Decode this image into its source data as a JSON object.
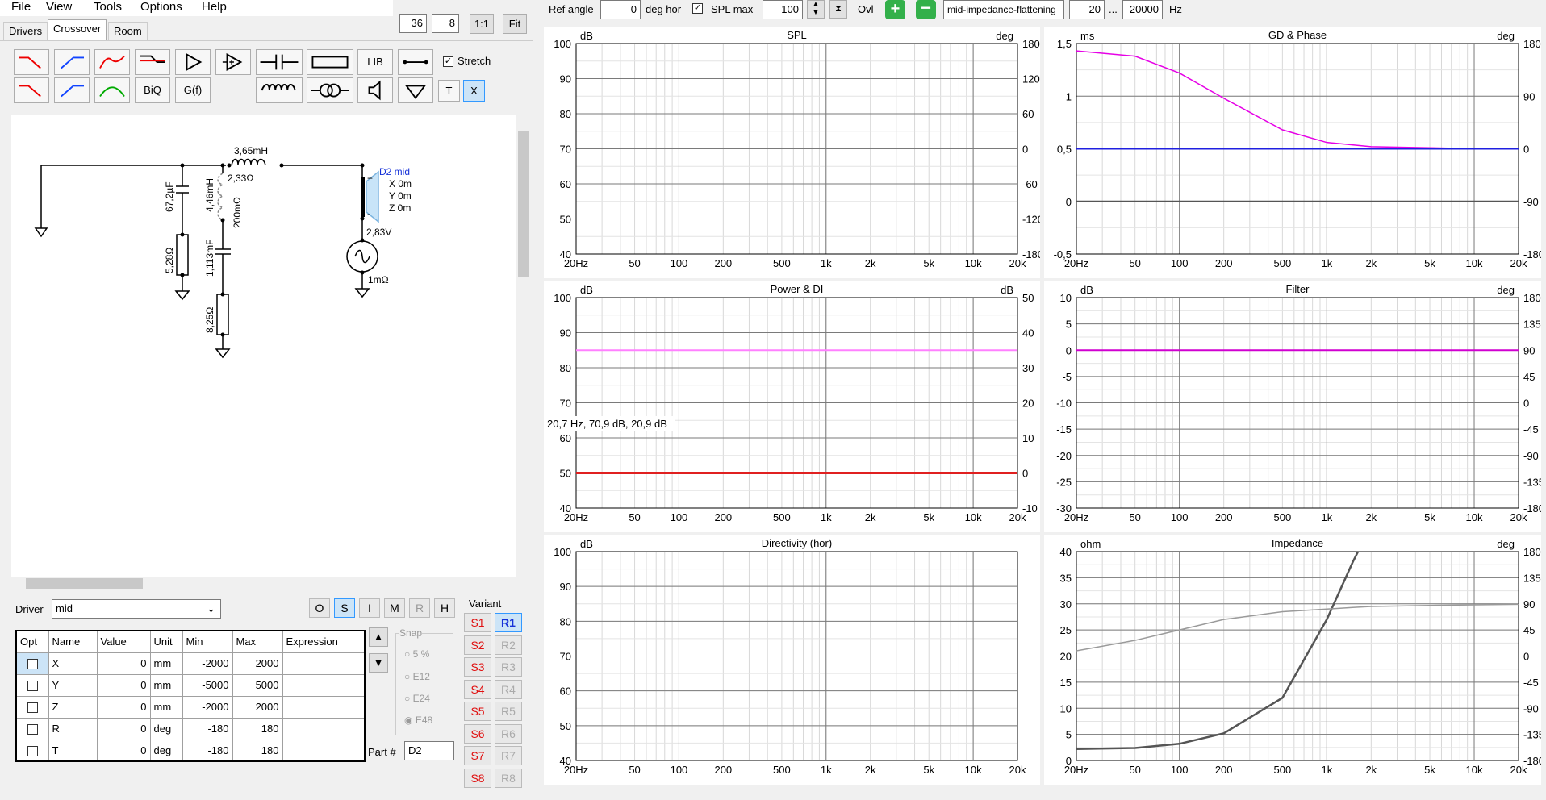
{
  "menu": [
    "File",
    "View",
    "Tools",
    "Options",
    "Help"
  ],
  "tabs": [
    "Drivers",
    "Crossover",
    "Room"
  ],
  "zoom": {
    "a": "36",
    "b": "8",
    "one": "1:1",
    "fit": "Fit"
  },
  "toolbar": {
    "lib": "LIB",
    "stretch": "Stretch",
    "biq": "BiQ",
    "gf": "G(f)",
    "t": "T",
    "x": "X"
  },
  "top": {
    "ref_angle_label": "Ref angle",
    "ref_angle": "0",
    "deg_hor": "deg hor",
    "spl_max_label": "SPL max",
    "spl_max": "100",
    "ovl": "Ovl",
    "preset": "mid-impedance-flattening",
    "f_lo": "20",
    "dots": "...",
    "f_hi": "20000",
    "hz": "Hz"
  },
  "schematic": {
    "L1": "3,65mH",
    "R1": "2,33Ω",
    "C1": "67,2µF",
    "L2": "4,46mH",
    "R2": "200mΩ",
    "R3": "5,28Ω",
    "C2": "1,113mF",
    "R4": "8,25Ω",
    "driver": "D2 mid",
    "x": "X 0m",
    "y": "Y 0m",
    "z": "Z 0m",
    "v": "2,83V",
    "rs": "1mΩ",
    "plus": "+",
    "minus": "-"
  },
  "driver": {
    "label": "Driver",
    "value": "mid",
    "modes": [
      "O",
      "S",
      "I",
      "M",
      "R",
      "H"
    ]
  },
  "table": {
    "headers": [
      "Opt",
      "Name",
      "Value",
      "Unit",
      "Min",
      "Max",
      "Expression"
    ],
    "rows": [
      [
        "X",
        "0",
        "mm",
        "-2000",
        "2000",
        ""
      ],
      [
        "Y",
        "0",
        "mm",
        "-5000",
        "5000",
        ""
      ],
      [
        "Z",
        "0",
        "mm",
        "-2000",
        "2000",
        ""
      ],
      [
        "R",
        "0",
        "deg",
        "-180",
        "180",
        ""
      ],
      [
        "T",
        "0",
        "deg",
        "-180",
        "180",
        ""
      ]
    ]
  },
  "snap": {
    "label": "Snap",
    "options": [
      "5 %",
      "E12",
      "E24",
      "E48"
    ]
  },
  "part": {
    "label": "Part #",
    "value": "D2"
  },
  "variant": {
    "label": "Variant",
    "s": [
      "S1",
      "S2",
      "S3",
      "S4",
      "S5",
      "S6",
      "S7",
      "S8"
    ],
    "r": [
      "R1",
      "R2",
      "R3",
      "R4",
      "R5",
      "R6",
      "R7",
      "R8"
    ]
  },
  "x_ticks": [
    "20Hz",
    "50",
    "100",
    "200",
    "500",
    "1k",
    "2k",
    "5k",
    "10k",
    "20k"
  ],
  "charts": {
    "spl": {
      "title": "SPL",
      "lunit": "dB",
      "runit": "deg",
      "yl": [
        "100",
        "90",
        "80",
        "70",
        "60",
        "50",
        "40"
      ],
      "yr": [
        "180",
        "120",
        "60",
        "0",
        "-60",
        "-120",
        "-180"
      ]
    },
    "gd": {
      "title": "GD & Phase",
      "lunit": "ms",
      "runit": "deg",
      "yl": [
        "1,5",
        "1",
        "0,5",
        "0",
        "-0,5"
      ],
      "yr": [
        "180",
        "90",
        "0",
        "-90",
        "-180"
      ]
    },
    "power": {
      "title": "Power & DI",
      "lunit": "dB",
      "runit": "dB",
      "yl": [
        "100",
        "90",
        "80",
        "70",
        "60",
        "50",
        "40"
      ],
      "yr": [
        "50",
        "40",
        "30",
        "20",
        "10",
        "0",
        "-10"
      ],
      "readout": "20,7 Hz, 70,9 dB, 20,9 dB"
    },
    "filter": {
      "title": "Filter",
      "lunit": "dB",
      "runit": "deg",
      "yl": [
        "10",
        "5",
        "0",
        "-5",
        "-10",
        "-15",
        "-20",
        "-25",
        "-30"
      ],
      "yr": [
        "180",
        "135",
        "90",
        "45",
        "0",
        "-45",
        "-90",
        "-135",
        "-180"
      ]
    },
    "dir": {
      "title": "Directivity (hor)",
      "lunit": "dB",
      "runit": "",
      "yl": [
        "100",
        "90",
        "80",
        "70",
        "60",
        "50",
        "40"
      ],
      "yr": []
    },
    "imp": {
      "title": "Impedance",
      "lunit": "ohm",
      "runit": "deg",
      "yl": [
        "40",
        "35",
        "30",
        "25",
        "20",
        "15",
        "10",
        "5",
        "0"
      ],
      "yr": [
        "180",
        "135",
        "90",
        "45",
        "0",
        "-45",
        "-90",
        "-135",
        "-180"
      ]
    }
  },
  "chart_data": [
    {
      "type": "line",
      "title": "GD & Phase",
      "x": [
        20,
        50,
        100,
        200,
        500,
        1000,
        2000,
        5000,
        10000,
        20000
      ],
      "series": [
        {
          "values": [
            1.43,
            1.38,
            1.22,
            0.98,
            0.68,
            0.56,
            0.52,
            0.51,
            0.5,
            0.5
          ]
        },
        {
          "values": [
            0.5,
            0.5,
            0.5,
            0.5,
            0.5,
            0.5,
            0.5,
            0.5,
            0.5,
            0.5
          ]
        },
        {
          "values": [
            0,
            0,
            0,
            0,
            0,
            0,
            0,
            0,
            0,
            0
          ]
        }
      ]
    },
    {
      "type": "line",
      "title": "Power & DI",
      "x": [
        20,
        20000
      ],
      "series": [
        {
          "values": [
            85,
            85
          ]
        },
        {
          "values": [
            50,
            50
          ]
        }
      ]
    },
    {
      "type": "line",
      "title": "Filter",
      "x": [
        20,
        20000
      ],
      "series": [
        {
          "values": [
            0,
            0
          ]
        }
      ]
    },
    {
      "type": "line",
      "title": "Impedance",
      "x": [
        20,
        50,
        100,
        200,
        500,
        1000,
        1500,
        2000,
        5000,
        10000,
        20000
      ],
      "series": [
        {
          "values": [
            2.2,
            2.4,
            3.2,
            5.2,
            12,
            27,
            38,
            45,
            45,
            45,
            45
          ]
        },
        {
          "values": [
            21,
            23,
            25,
            27,
            28.5,
            29,
            29.3,
            29.5,
            29.7,
            29.8,
            29.9
          ]
        }
      ]
    }
  ]
}
